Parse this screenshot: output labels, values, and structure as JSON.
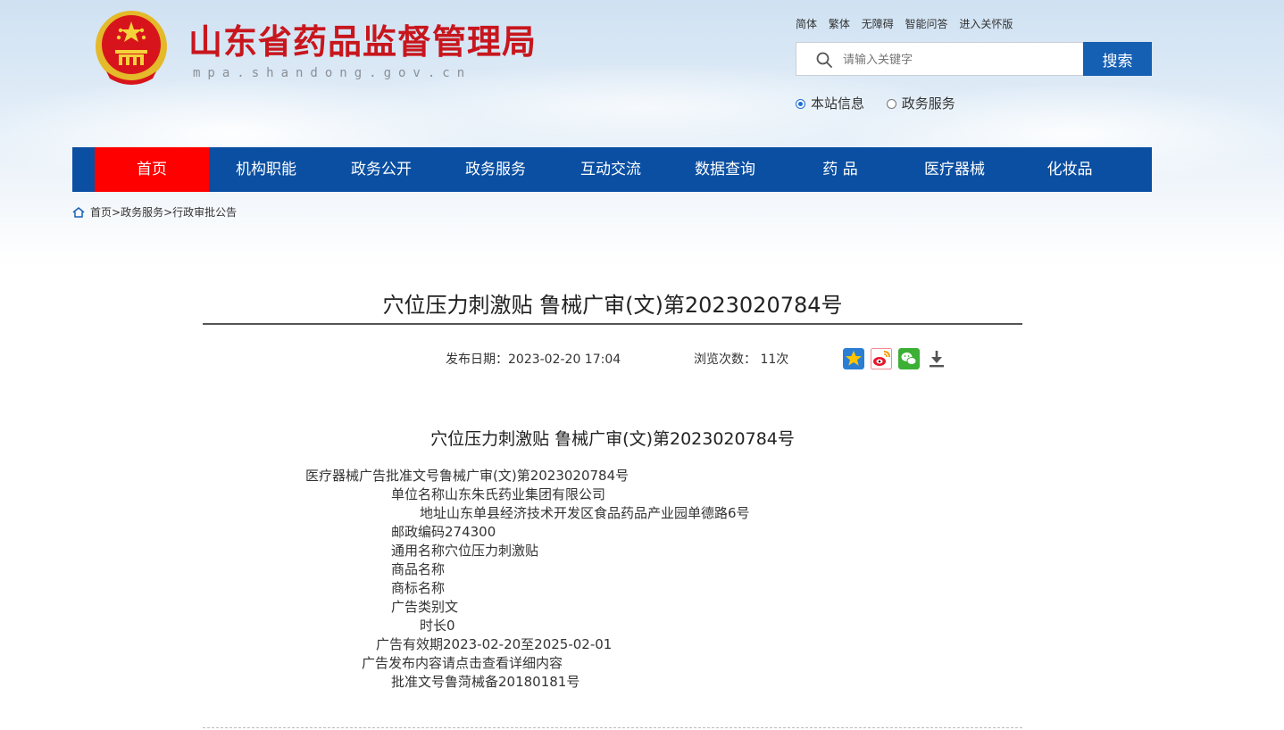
{
  "header": {
    "site_title": "山东省药品监督管理局",
    "site_domain": "mpa.shandong.gov.cn",
    "top_links": [
      "简体",
      "繁体",
      "无障碍",
      "智能问答",
      "进入关怀版"
    ],
    "search": {
      "placeholder": "请输入关键字",
      "button_label": "搜索"
    },
    "scope_options": [
      {
        "label": "本站信息",
        "selected": true
      },
      {
        "label": "政务服务",
        "selected": false
      }
    ]
  },
  "nav": {
    "items": [
      "首页",
      "机构职能",
      "政务公开",
      "政务服务",
      "互动交流",
      "数据查询",
      "药 品",
      "医疗器械",
      "化妆品"
    ],
    "active_index": 0
  },
  "breadcrumb": {
    "home": "首页",
    "sep": ">",
    "level1": "政务服务",
    "level2": "行政审批公告"
  },
  "article": {
    "title": "穴位压力刺激贴 鲁械广审(文)第2023020784号",
    "publish_date": "发布日期：2023-02-20 17:04",
    "views": "浏览次数： 11次",
    "share_icons": [
      "favorite-icon",
      "weibo-icon",
      "wechat-icon",
      "download-icon"
    ],
    "content_title": "穴位压力刺激贴 鲁械广审(文)第2023020784号",
    "fields": [
      "医疗器械广告批准文号鲁械广审(文)第2023020784号",
      "单位名称山东朱氏药业集团有限公司",
      "地址山东单县经济技术开发区食品药品产业园单德路6号",
      "邮政编码274300",
      "通用名称穴位压力刺激贴",
      "商品名称",
      "商标名称",
      "广告类别文",
      "时长0",
      "广告有效期2023-02-20至2025-02-01",
      "广告发布内容请点击查看详细内容",
      "批准文号鲁菏械备20180181号"
    ]
  },
  "colors": {
    "brand_red": "#c8161d",
    "nav_blue": "#0a4fa2",
    "nav_active": "#fe0000",
    "search_button": "#1660b4"
  }
}
